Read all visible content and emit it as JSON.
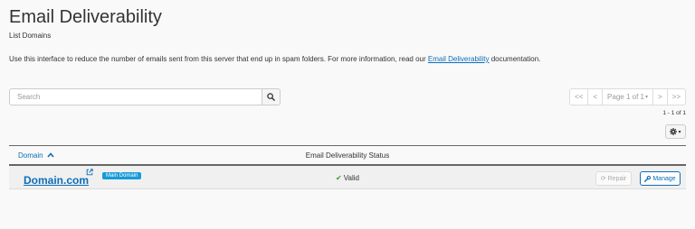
{
  "header": {
    "title": "Email Deliverability",
    "subtitle": "List Domains"
  },
  "intro": {
    "text_before": "Use this interface to reduce the number of emails sent from this server that end up in spam folders. For more information, read our ",
    "link_text": "Email Deliverability",
    "text_after": " documentation."
  },
  "search": {
    "placeholder": "Search",
    "icon": "search-icon"
  },
  "pagination": {
    "first": "<<",
    "prev": "<",
    "page_label": "Page 1 of 1",
    "caret": "▾",
    "next": ">",
    "last": ">>",
    "range": "1 - 1 of 1"
  },
  "settings": {
    "icon": "gear-icon",
    "caret": "▾"
  },
  "table": {
    "columns": {
      "domain": "Domain",
      "status": "Email Deliverability Status"
    },
    "sort_icon": "chevron-up-icon",
    "rows": [
      {
        "domain": "Domain.com",
        "badge": "Main Domain",
        "status": "Valid",
        "repair_label": "Repair",
        "manage_label": "Manage"
      }
    ]
  },
  "colors": {
    "accent": "#0d6eb8",
    "badge": "#179bd7",
    "valid": "#3c9a3c"
  }
}
